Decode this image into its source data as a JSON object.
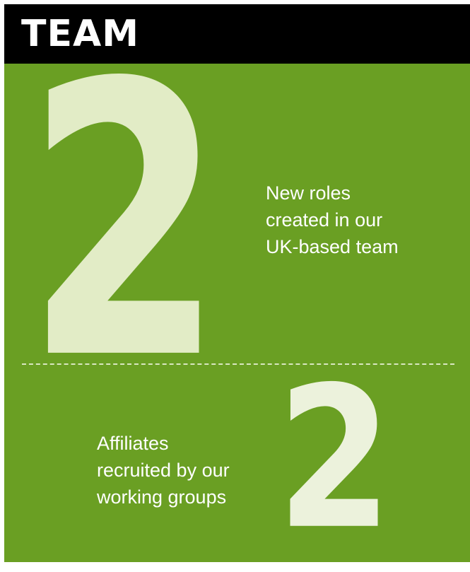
{
  "header": {
    "title": "TEAM"
  },
  "stats": [
    {
      "value": "2",
      "caption_lines": [
        "New roles",
        "created in our",
        "UK-based team"
      ]
    },
    {
      "value": "2",
      "caption_lines": [
        "Affiliates",
        "recruited by our",
        "working groups"
      ]
    }
  ],
  "colors": {
    "header_background": "#000000",
    "panel_background": "#6a9f23",
    "numeral": "#e2ecc6",
    "text": "#ffffff"
  }
}
